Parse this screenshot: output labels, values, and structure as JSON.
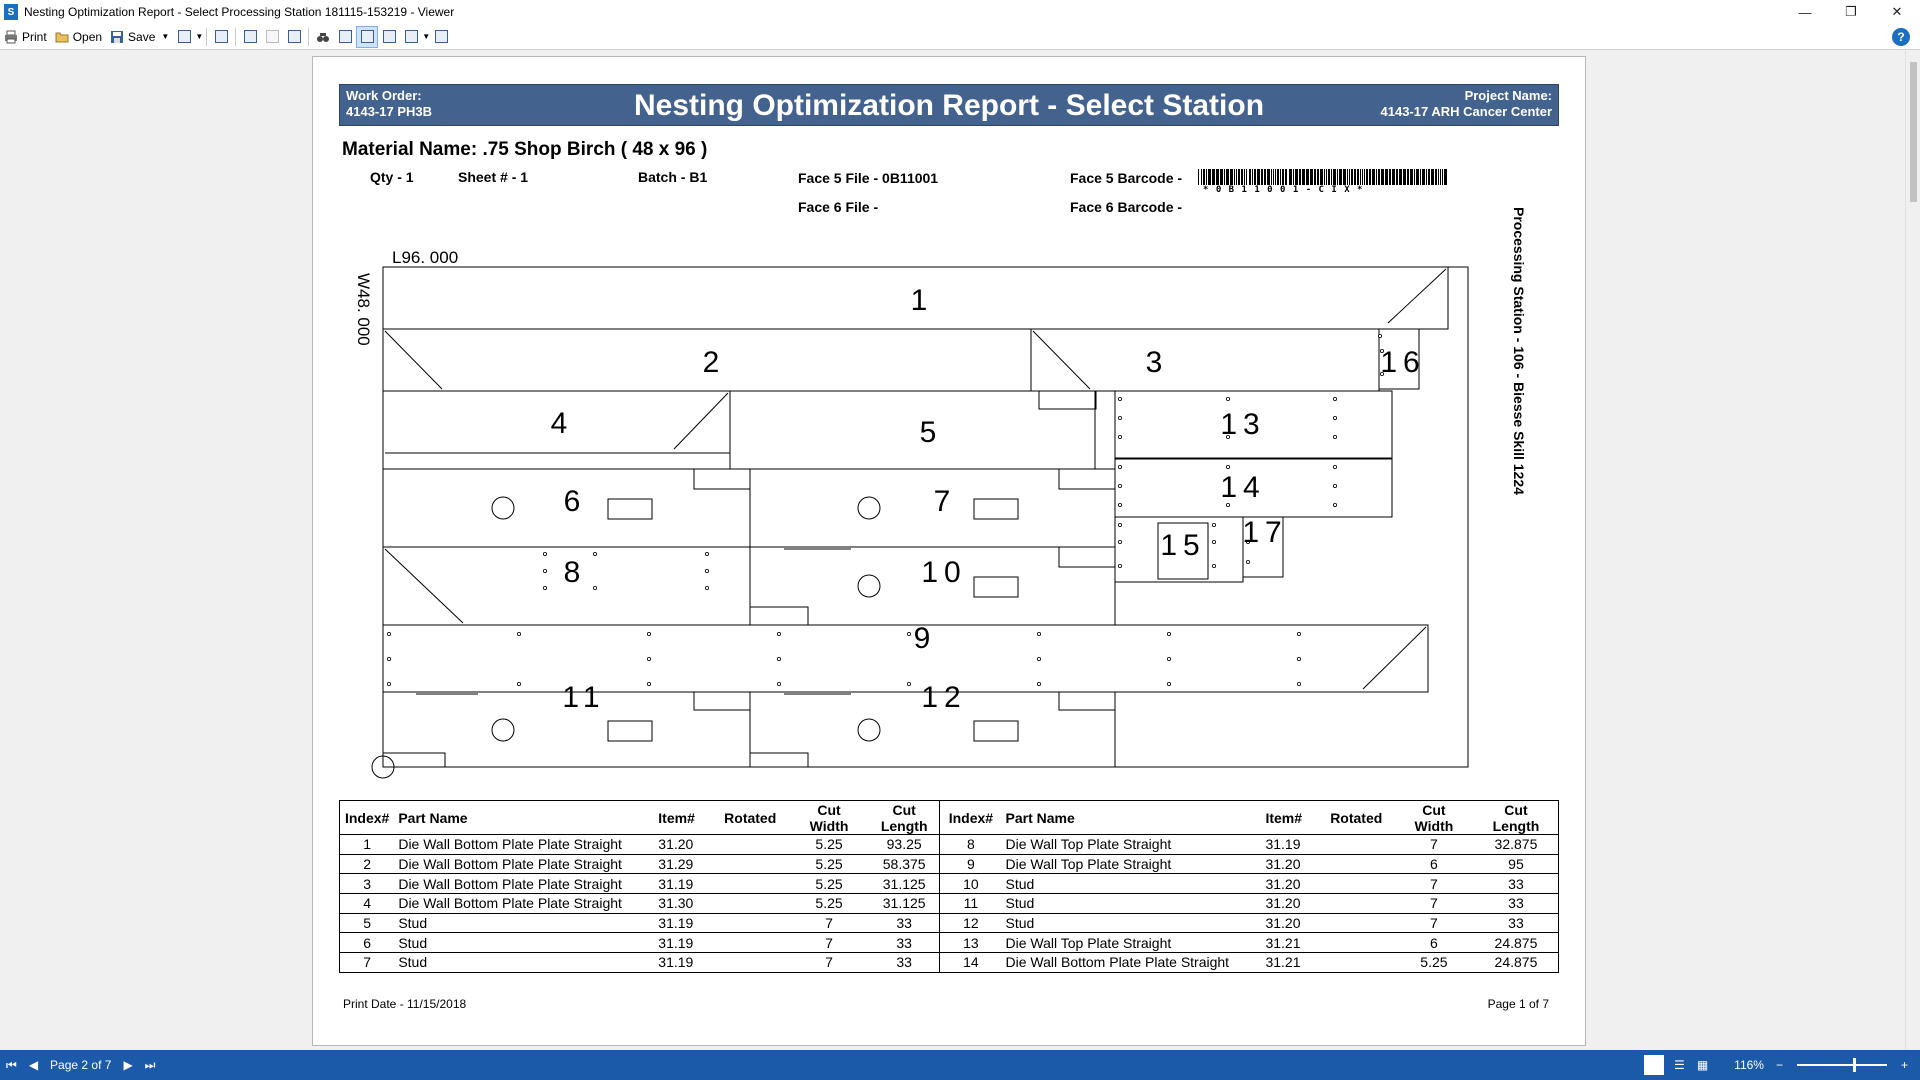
{
  "window": {
    "title": "Nesting Optimization Report - Select Processing Station 181115-153219 - Viewer",
    "minimize": "—",
    "maximize": "❐",
    "close": "✕"
  },
  "toolbar": {
    "print": "Print",
    "open": "Open",
    "save": "Save",
    "help": "?"
  },
  "report": {
    "work_order_label": "Work Order:",
    "work_order_value": "4143-17 PH3B",
    "title": "Nesting Optimization Report - Select Station",
    "project_label": "Project Name:",
    "project_value": "4143-17 ARH Cancer Center",
    "material": "Material Name: .75 Shop Birch  ( 48 x 96 )",
    "qty": "Qty - 1",
    "sheet": "Sheet # - 1",
    "batch": "Batch - B1",
    "face5_file": "Face 5 File - 0B11001",
    "face5_barcode": "Face 5 Barcode -",
    "barcode_text": "* 0 B 1 1 0 0 1 - C I X *",
    "face6_file": "Face 6 File -",
    "face6_barcode": "Face 6 Barcode -",
    "station": "Processing Station - 106 - Biesse Skill 1224",
    "length_label": "L96. 000",
    "width_label": "W48. 000",
    "part_labels": [
      "1",
      "2",
      "3",
      "16",
      "4",
      "5",
      "13",
      "14",
      "6",
      "7",
      "15",
      "17",
      "8",
      "10",
      "9",
      "11",
      "12"
    ],
    "print_date": "Print Date - 11/15/2018",
    "page_of": "Page 1 of 7"
  },
  "table": {
    "headers": {
      "index": "Index#",
      "part_name": "Part Name",
      "item": "Item#",
      "rotated": "Rotated",
      "cut_width_1": "Cut",
      "cut_width_2": "Width",
      "cut_length_1": "Cut",
      "cut_length_2": "Length"
    },
    "left": [
      {
        "i": "1",
        "name": "Die Wall Bottom Plate Plate Straight",
        "item": "31.20",
        "rot": "",
        "w": "5.25",
        "l": "93.25"
      },
      {
        "i": "2",
        "name": "Die Wall Bottom Plate Plate Straight",
        "item": "31.29",
        "rot": "",
        "w": "5.25",
        "l": "58.375"
      },
      {
        "i": "3",
        "name": "Die Wall Bottom Plate Plate Straight",
        "item": "31.19",
        "rot": "",
        "w": "5.25",
        "l": "31.125"
      },
      {
        "i": "4",
        "name": "Die Wall Bottom Plate Plate Straight",
        "item": "31.30",
        "rot": "",
        "w": "5.25",
        "l": "31.125"
      },
      {
        "i": "5",
        "name": "Stud",
        "item": "31.19",
        "rot": "",
        "w": "7",
        "l": "33"
      },
      {
        "i": "6",
        "name": "Stud",
        "item": "31.19",
        "rot": "",
        "w": "7",
        "l": "33"
      },
      {
        "i": "7",
        "name": "Stud",
        "item": "31.19",
        "rot": "",
        "w": "7",
        "l": "33"
      }
    ],
    "right": [
      {
        "i": "8",
        "name": "Die Wall Top Plate Straight",
        "item": "31.19",
        "rot": "",
        "w": "7",
        "l": "32.875"
      },
      {
        "i": "9",
        "name": "Die Wall Top Plate Straight",
        "item": "31.20",
        "rot": "",
        "w": "6",
        "l": "95"
      },
      {
        "i": "10",
        "name": "Stud",
        "item": "31.20",
        "rot": "",
        "w": "7",
        "l": "33"
      },
      {
        "i": "11",
        "name": "Stud",
        "item": "31.20",
        "rot": "",
        "w": "7",
        "l": "33"
      },
      {
        "i": "12",
        "name": "Stud",
        "item": "31.20",
        "rot": "",
        "w": "7",
        "l": "33"
      },
      {
        "i": "13",
        "name": "Die Wall Top Plate Straight",
        "item": "31.21",
        "rot": "",
        "w": "6",
        "l": "24.875"
      },
      {
        "i": "14",
        "name": "Die Wall Bottom Plate Plate Straight",
        "item": "31.21",
        "rot": "",
        "w": "5.25",
        "l": "24.875"
      }
    ]
  },
  "status": {
    "page_indicator": "Page 2 of 7",
    "zoom": "116%",
    "zoom_minus": "−",
    "zoom_plus": "+"
  },
  "colors": {
    "header_bg": "#44628e",
    "statusbar_bg": "#1a5aa8"
  }
}
